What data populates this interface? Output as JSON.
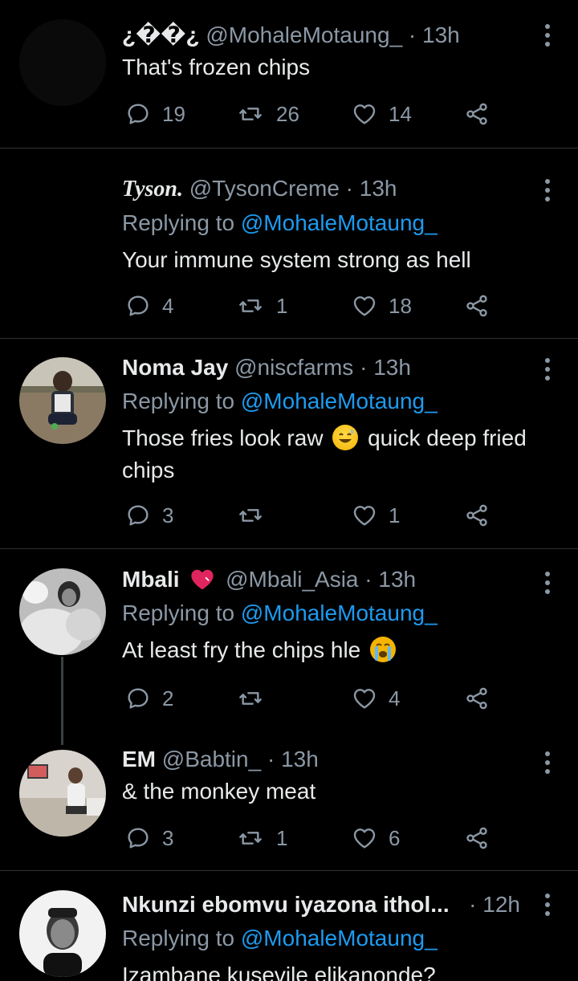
{
  "tweets": [
    {
      "name": "¿��¿",
      "handle": "@MohaleMotaung_",
      "time": "13h",
      "replying_to": null,
      "body": "That's frozen chips",
      "replies": "19",
      "retweets": "26",
      "likes": "14"
    },
    {
      "name": "Tyson.",
      "handle": "@TysonCreme",
      "time": "13h",
      "replying_to_prefix": "Replying to",
      "replying_to": "@MohaleMotaung_",
      "body": "Your immune system strong as hell",
      "replies": "4",
      "retweets": "1",
      "likes": "18"
    },
    {
      "name": "Noma Jay",
      "handle": "@niscfarms",
      "time": "13h",
      "replying_to_prefix": "Replying to",
      "replying_to": "@MohaleMotaung_",
      "body_before_emoji": "Those fries look raw",
      "body_after_emoji": "quick deep fried chips",
      "replies": "3",
      "retweets": "",
      "likes": "1"
    },
    {
      "name": "Mbali",
      "handle": "@Mbali_Asia",
      "time": "13h",
      "replying_to_prefix": "Replying to",
      "replying_to": "@MohaleMotaung_",
      "body": "At least fry the chips hle",
      "replies": "2",
      "retweets": "",
      "likes": "4"
    },
    {
      "name": "EM",
      "handle": "@Babtin_",
      "time": "13h",
      "replying_to": null,
      "body": "& the monkey meat",
      "replies": "3",
      "retweets": "1",
      "likes": "6"
    },
    {
      "name": "Nkunzi ebomvu iyazona ithol...",
      "handle": "",
      "time": "12h",
      "replying_to_prefix": "Replying to",
      "replying_to": "@MohaleMotaung_",
      "body": "Izambane kusevile elikanonde?"
    }
  ],
  "dot": "·",
  "icons": [
    "reply-icon",
    "retweet-icon",
    "like-icon",
    "share-icon",
    "more-options-icon"
  ],
  "colors": {
    "background": "#000000",
    "muted": "#8b98a5",
    "link": "#1d9bf0",
    "divider": "#2f3336",
    "heart_emoji": "#e0245e"
  }
}
